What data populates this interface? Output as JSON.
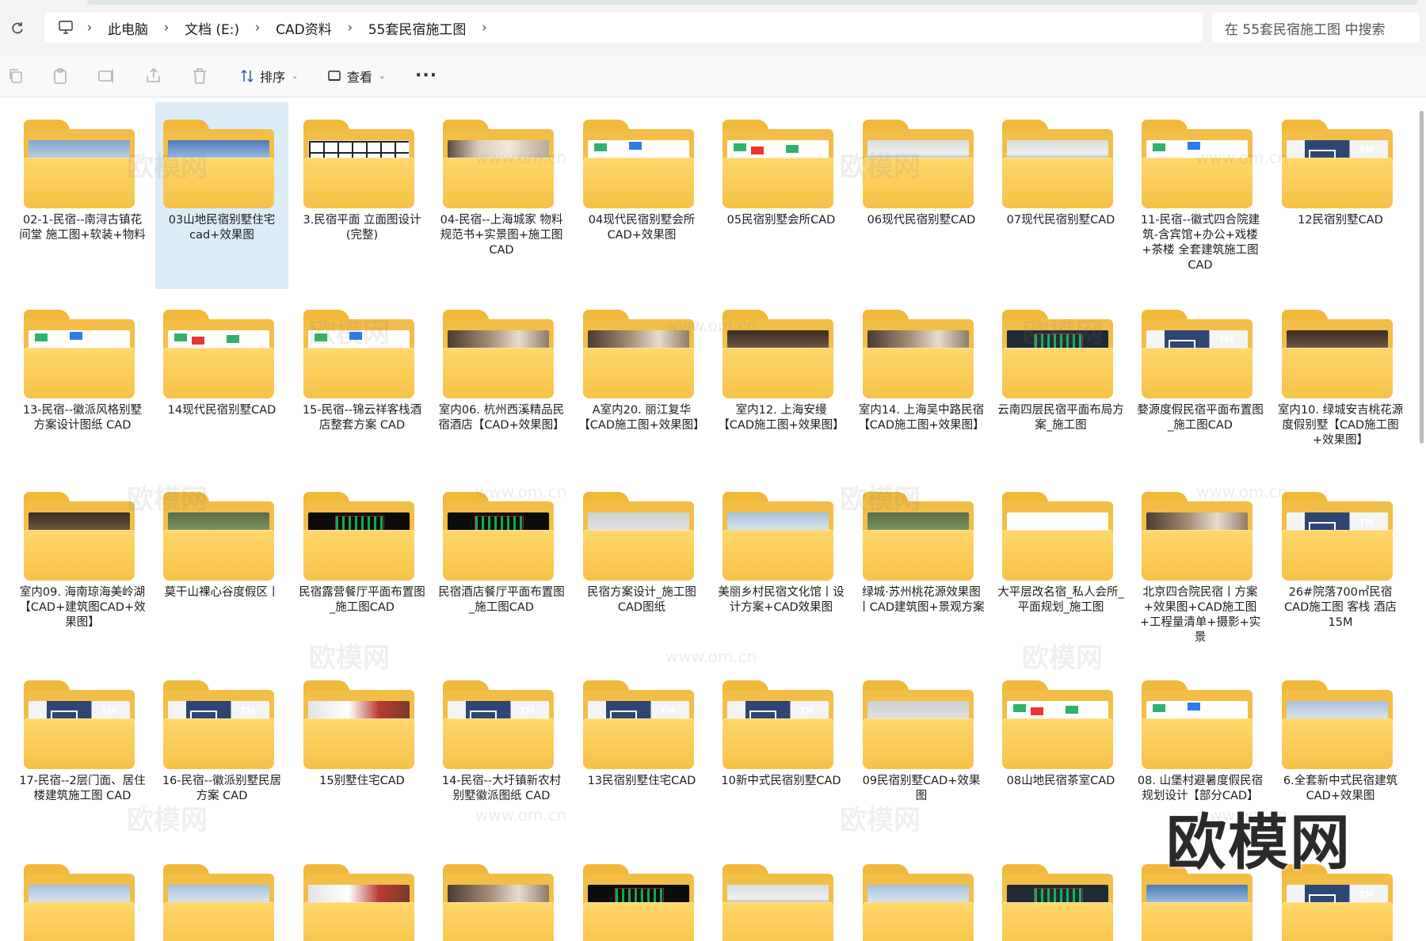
{
  "address_bar": {
    "breadcrumbs": [
      "此电脑",
      "文档 (E:)",
      "CAD资料",
      "55套民宿施工图"
    ],
    "search_placeholder": "在 55套民宿施工图 中搜索"
  },
  "toolbar": {
    "sort_label": "排序",
    "view_label": "查看"
  },
  "watermark": {
    "text": "欧模网",
    "url": "www.om.cn"
  },
  "folders": [
    {
      "name": "02-1-民宿--南浔古镇花间堂 施工图+软装+物料",
      "thumb": "sky"
    },
    {
      "name": "03山地民宿别墅住宅cad+效果图",
      "thumb": "house",
      "selected": true
    },
    {
      "name": "3.民宿平面 立面图设计(完整)",
      "thumb": "plan"
    },
    {
      "name": "04-民宿--上海城家 物料规范书+实景图+施工图 CAD",
      "thumb": "interior"
    },
    {
      "name": "04现代民宿别墅会所CAD+效果图",
      "thumb": "white-dots"
    },
    {
      "name": "05民宿别墅会所CAD",
      "thumb": "white-dots"
    },
    {
      "name": "06现代民宿别墅CAD",
      "thumb": "model"
    },
    {
      "name": "07现代民宿别墅CAD",
      "thumb": "model"
    },
    {
      "name": "11-民宿--徽式四合院建筑-含宾馆+办公+戏楼+茶楼 全套建筑施工图CAD",
      "thumb": "white-dots"
    },
    {
      "name": "12民宿别墅CAD",
      "thumb": "tm"
    },
    {
      "name": "13-民宿--徽派风格别墅方案设计图纸 CAD",
      "thumb": "white-dots"
    },
    {
      "name": "14现代民宿别墅CAD",
      "thumb": "white-dots"
    },
    {
      "name": "15-民宿--锦云祥客栈酒店整套方案 CAD",
      "thumb": "white-dots"
    },
    {
      "name": "室内06. 杭州西溪精品民宿酒店【CAD+效果图】",
      "thumb": "room"
    },
    {
      "name": "A室内20. 丽江复华【CAD施工图+效果图】",
      "thumb": "room"
    },
    {
      "name": "室内12. 上海安缦【CAD施工图+效果图】",
      "thumb": "wood"
    },
    {
      "name": "室内14. 上海吴中路民宿【CAD施工图+效果图】",
      "thumb": "room"
    },
    {
      "name": "云南四层民宿平面布局方案_施工图",
      "thumb": "dark"
    },
    {
      "name": "婺源度假民宿平面布置图_施工图CAD",
      "thumb": "tm"
    },
    {
      "name": "室内10. 绿城安吉桃花源度假别墅【CAD施工图+效果图】",
      "thumb": "wood"
    },
    {
      "name": "室内09. 海南琼海美岭湖【CAD+建筑图CAD+效果图】",
      "thumb": "wood"
    },
    {
      "name": "莫干山裸心谷度假区丨",
      "thumb": "green"
    },
    {
      "name": "民宿露营餐厅平面布置图_施工图CAD",
      "thumb": "black"
    },
    {
      "name": "民宿酒店餐厅平面布置图_施工图CAD",
      "thumb": "black"
    },
    {
      "name": "民宿方案设计_施工图CAD图纸",
      "thumb": "grey"
    },
    {
      "name": "美丽乡村民宿文化馆丨设计方案+CAD效果图",
      "thumb": "mount"
    },
    {
      "name": "绿城·苏州桃花源效果图丨CAD建筑图+景观方案",
      "thumb": "green"
    },
    {
      "name": "大平层改名宿_私人会所_平面规划_施工图",
      "thumb": "white"
    },
    {
      "name": "北京四合院民宿丨方案+效果图+CAD施工图+工程量清单+摄影+实景",
      "thumb": "room"
    },
    {
      "name": "26#院落700㎡民宿CAD施工图 客栈 酒店 15M",
      "thumb": "tm"
    },
    {
      "name": "17-民宿--2层门面、居住楼建筑施工图 CAD",
      "thumb": "tm"
    },
    {
      "name": "16-民宿--徽派别墅民居方案 CAD",
      "thumb": "tm"
    },
    {
      "name": "15别墅住宅CAD",
      "thumb": "red"
    },
    {
      "name": "14-民宿--大圩镇新农村别墅徽派图纸 CAD",
      "thumb": "tm"
    },
    {
      "name": "13民宿别墅住宅CAD",
      "thumb": "tm"
    },
    {
      "name": "10新中式民宿别墅CAD",
      "thumb": "tm"
    },
    {
      "name": "09民宿别墅CAD+效果图",
      "thumb": "grey"
    },
    {
      "name": "08山地民宿茶室CAD",
      "thumb": "white-dots"
    },
    {
      "name": "08. 山堡村避暑度假民宿规划设计【部分CAD】",
      "thumb": "white-dots"
    },
    {
      "name": "6.全套新中式民宿建筑CAD+效果图",
      "thumb": "mount"
    },
    {
      "name": "",
      "thumb": "mount"
    },
    {
      "name": "",
      "thumb": "mount"
    },
    {
      "name": "",
      "thumb": "red"
    },
    {
      "name": "",
      "thumb": "room"
    },
    {
      "name": "",
      "thumb": "black"
    },
    {
      "name": "",
      "thumb": "model"
    },
    {
      "name": "",
      "thumb": "mount"
    },
    {
      "name": "",
      "thumb": "dark"
    },
    {
      "name": "",
      "thumb": "house"
    },
    {
      "name": "",
      "thumb": "tm"
    }
  ]
}
